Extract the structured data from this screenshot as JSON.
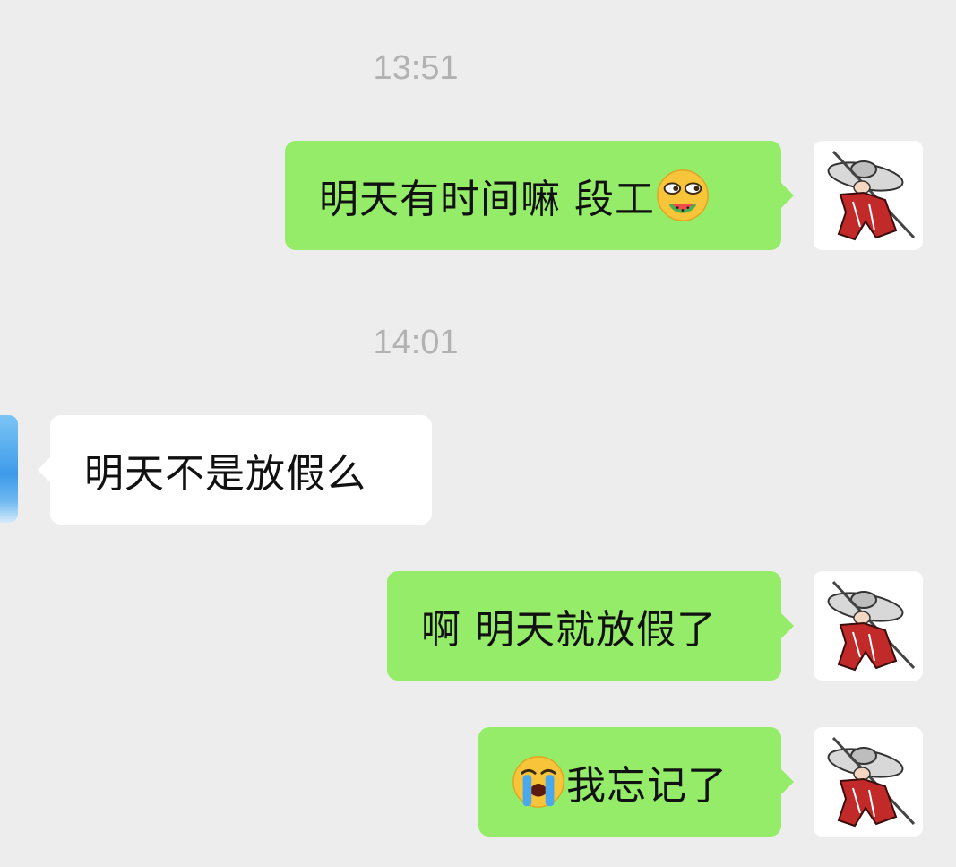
{
  "chat": {
    "timestamps": {
      "first": "13:51",
      "second": "14:01"
    },
    "messages": [
      {
        "sender": "me",
        "text": "明天有时间嘛 段工",
        "emoji": "drooling-face-eating-watermelon-icon"
      },
      {
        "sender": "other",
        "text": "明天不是放假么"
      },
      {
        "sender": "me",
        "text": "啊 明天就放假了"
      },
      {
        "sender": "me",
        "text": "我忘记了",
        "emoji_prefix": "loudly-crying-face-icon"
      }
    ]
  },
  "colors": {
    "background": "#ededed",
    "sent_bubble": "#95ec69",
    "received_bubble": "#ffffff",
    "timestamp": "#b2b2b2"
  }
}
